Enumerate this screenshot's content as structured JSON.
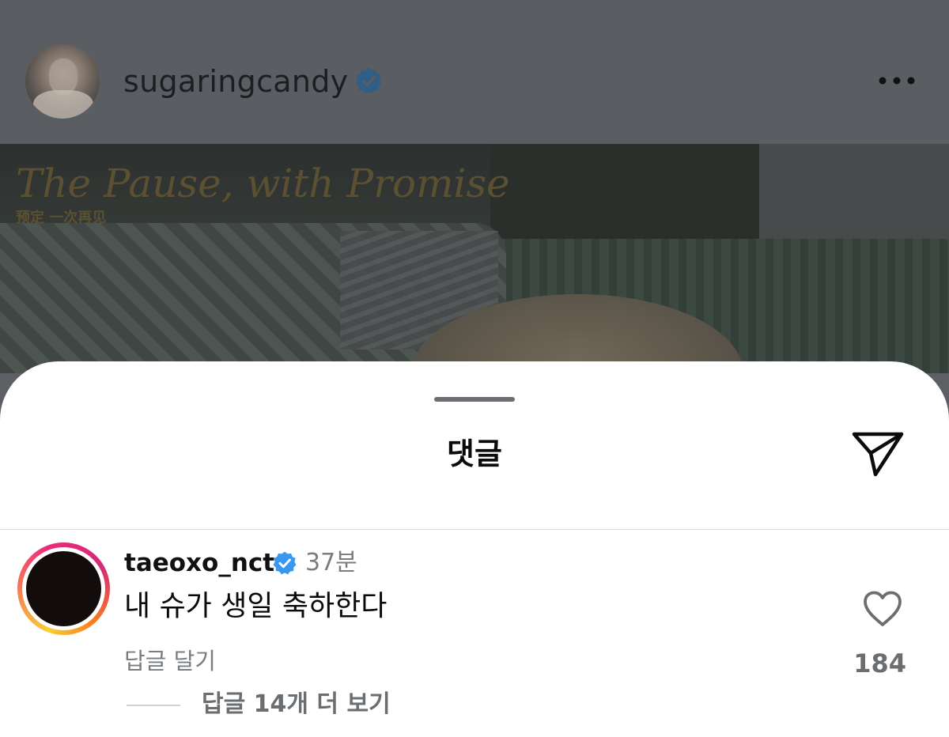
{
  "post_header": {
    "username": "sugaringcandy",
    "verified_icon": "verified-badge-icon",
    "more_icon": "more-horizontal-icon"
  },
  "post_image": {
    "title": "The Pause, with Promise",
    "subtitle": "预定 一次再见"
  },
  "comments_sheet": {
    "title": "댓글",
    "share_icon": "send-icon"
  },
  "comments": [
    {
      "username": "taeoxo_nct",
      "verified": true,
      "time": "37분",
      "text": "내 슈가 생일 축하한다",
      "reply_label": "답글 달기",
      "like_icon": "heart-outline-icon",
      "like_count": "184",
      "view_replies_label": "답글 14개 더 보기"
    }
  ],
  "colors": {
    "verified_blue": "#3897f0",
    "overlay_dim": "#5a5e62",
    "secondary_text": "#7a7d80"
  }
}
